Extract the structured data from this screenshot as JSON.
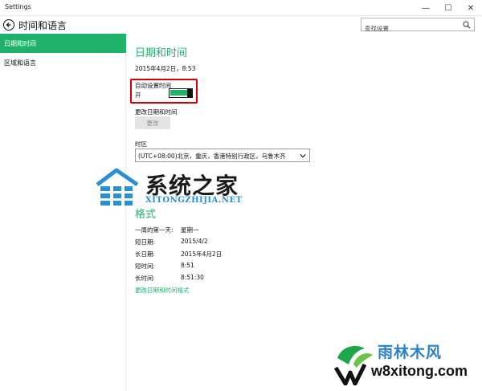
{
  "window": {
    "title": "Settings",
    "controls": {
      "minimize": "—",
      "maximize": "☐",
      "close": "✕"
    }
  },
  "header": {
    "title": "时间和语言",
    "search_placeholder": "查找设置"
  },
  "sidebar": {
    "items": [
      {
        "label": "日期和时间",
        "active": true
      },
      {
        "label": "区域和语言",
        "active": false
      }
    ]
  },
  "main": {
    "section_title": "日期和时间",
    "current_datetime": "2015年4月2日，8:53",
    "auto_time": {
      "label": "自动设置时间",
      "state_text": "开",
      "on": true
    },
    "change_datetime": {
      "label": "更改日期和时间",
      "button": "更改"
    },
    "timezone": {
      "label": "时区",
      "value": "(UTC+08:00)北京，重庆，香港特别行政区，乌鲁木齐"
    },
    "format": {
      "title": "格式",
      "rows": [
        {
          "label": "一周的第一天:",
          "value": "星期一"
        },
        {
          "label": "短日期:",
          "value": "2015/4/2"
        },
        {
          "label": "长日期:",
          "value": "2015年4月2日"
        },
        {
          "label": "短时间:",
          "value": "8:51"
        },
        {
          "label": "长时间:",
          "value": "8:51:30"
        }
      ],
      "link": "更改日期和时间格式"
    }
  },
  "watermarks": {
    "primary": {
      "cn": "系统之家",
      "en": "XITONGZHIJIA.NET"
    },
    "secondary": {
      "cn": "雨林木风",
      "en": "w8xitong.com"
    }
  },
  "colors": {
    "accent": "#1fb26b",
    "highlight": "#d40000",
    "link_blue": "#2a8fd6"
  }
}
